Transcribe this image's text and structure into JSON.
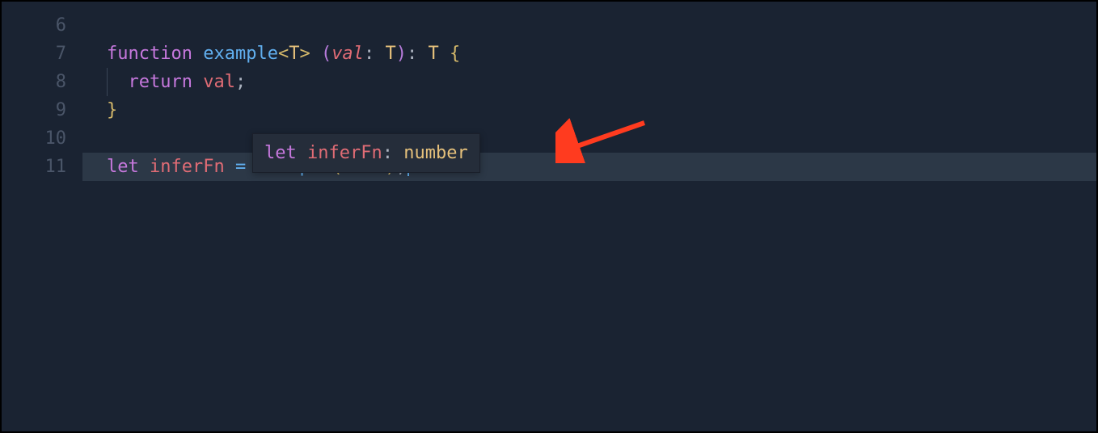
{
  "gutter": {
    "lines": [
      "6",
      "7",
      "8",
      "9",
      "10",
      "11"
    ]
  },
  "code": {
    "line6": "",
    "line7": {
      "function": "function",
      "name": "example",
      "lt": "<",
      "generic": "T",
      "gt": ">",
      "space": " ",
      "lparen": "(",
      "param": "val",
      "colon1": ": ",
      "ptype": "T",
      "rparen": ")",
      "colon2": ": ",
      "rtype": "T",
      "space2": " ",
      "lbrace": "{"
    },
    "line8": {
      "indent": "  ",
      "return": "return",
      "space": " ",
      "val": "val",
      "semi": ";"
    },
    "line9": {
      "rbrace": "}"
    },
    "line10": "",
    "line11": {
      "let": "let",
      "space1": " ",
      "varname": "inferFn",
      "space2": " ",
      "eq": "=",
      "space3": " ",
      "fn": "example",
      "lparen": "(",
      "num": "1200",
      "rparen": ")",
      "semi": ";"
    }
  },
  "tooltip": {
    "let": "let",
    "space1": " ",
    "varname": "inferFn",
    "colon": ": ",
    "type": "number"
  }
}
